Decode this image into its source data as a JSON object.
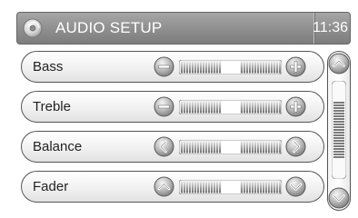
{
  "header": {
    "title": "AUDIO SETUP",
    "time": "11:36",
    "icon": "cd-icon"
  },
  "settings": [
    {
      "label": "Bass",
      "left_icon": "minus-icon",
      "right_icon": "plus-icon",
      "level": 0.5
    },
    {
      "label": "Treble",
      "left_icon": "minus-icon",
      "right_icon": "plus-icon",
      "level": 0.5
    },
    {
      "label": "Balance",
      "left_icon": "chevron-left-icon",
      "right_icon": "chevron-right-icon",
      "level": 0.5
    },
    {
      "label": "Fader",
      "left_icon": "chevron-up-icon",
      "right_icon": "chevron-down-icon",
      "level": 0.5
    }
  ],
  "scrollbar": {
    "up_icon": "chevron-up-icon",
    "down_icon": "chevron-down-icon",
    "position": 0.5
  }
}
